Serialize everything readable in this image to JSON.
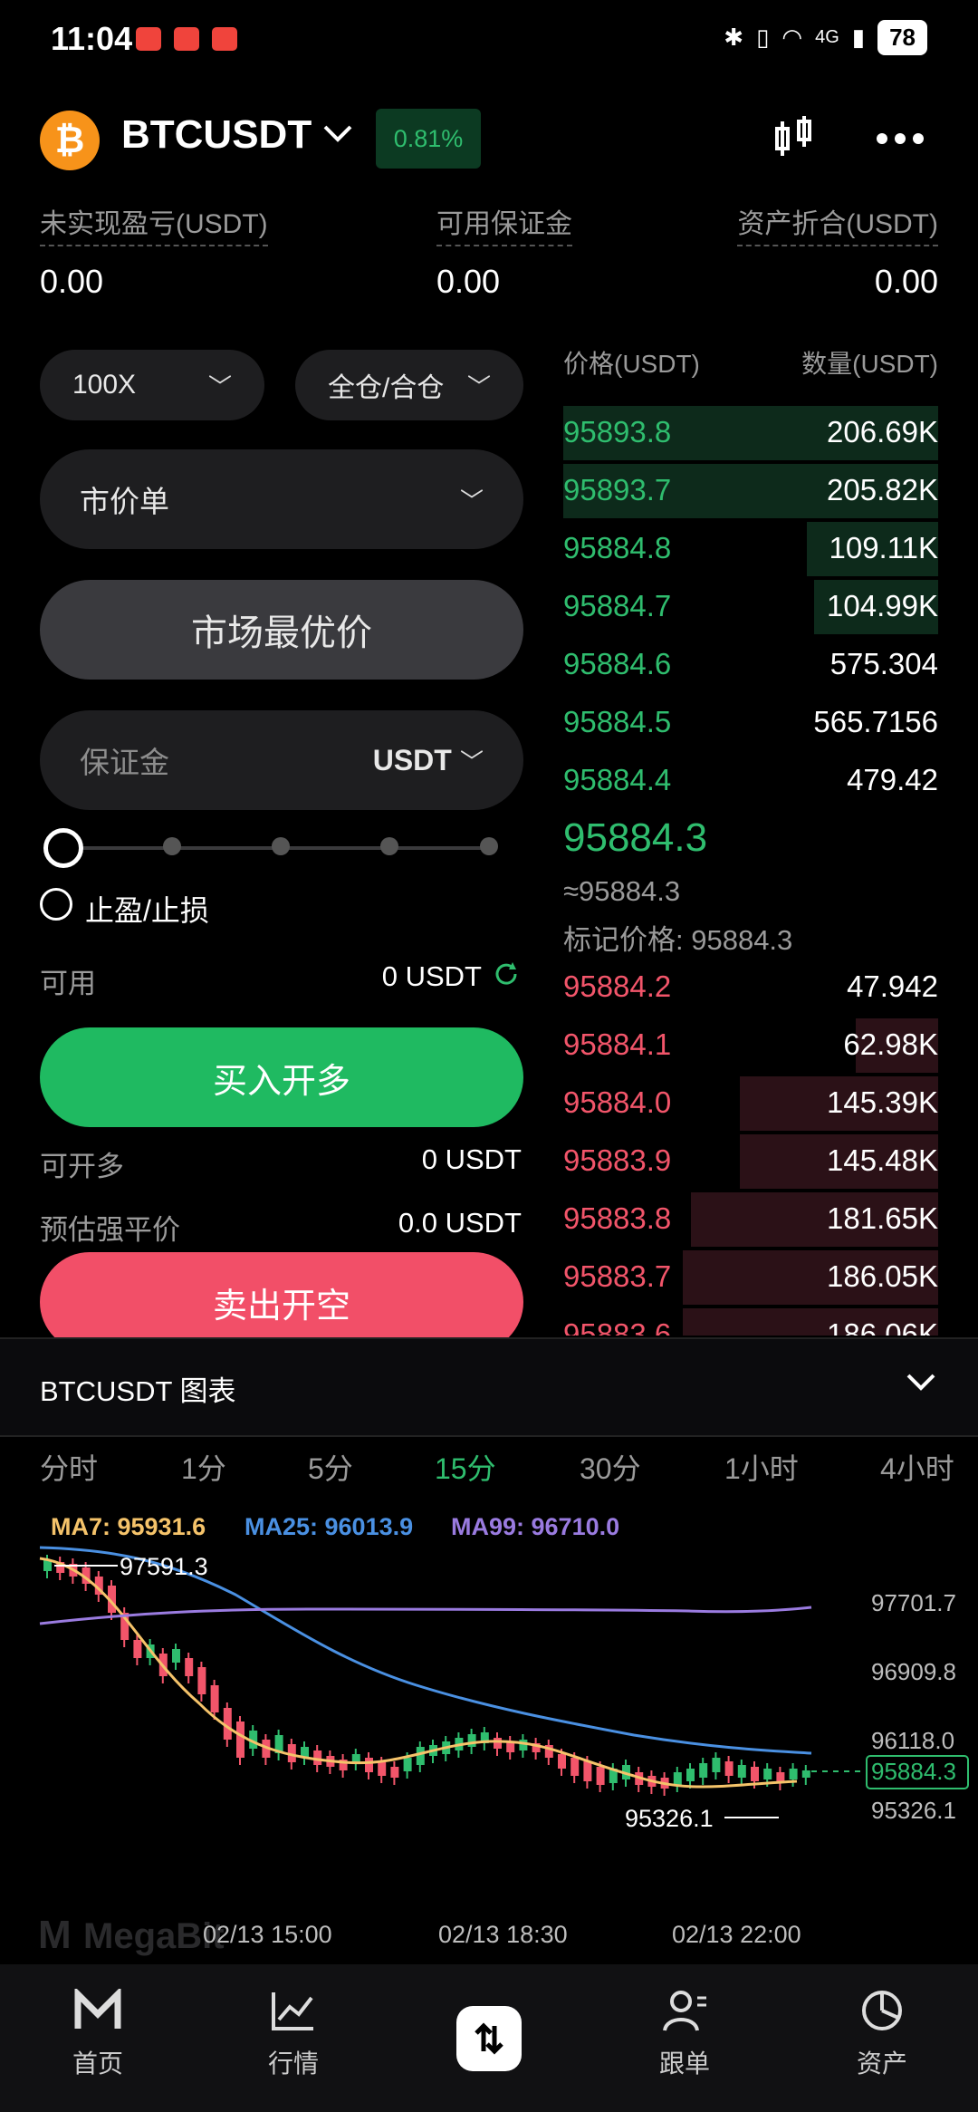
{
  "status_bar": {
    "time": "11:04",
    "battery": "78",
    "network": "4G"
  },
  "header": {
    "coin_symbol": "₿",
    "pair": "BTCUSDT",
    "change": "0.81%"
  },
  "balances": [
    {
      "label": "未实现盈亏(USDT)",
      "value": "0.00"
    },
    {
      "label": "可用保证金",
      "value": "0.00"
    },
    {
      "label": "资产折合(USDT)",
      "value": "0.00"
    }
  ],
  "order_form": {
    "leverage": "100X",
    "margin_mode": "全仓/合仓",
    "order_type": "市价单",
    "price_mode": "市场最优价",
    "margin_placeholder": "保证金",
    "margin_unit": "USDT",
    "tpsl_label": "止盈/止损",
    "available_label": "可用",
    "available_value": "0 USDT",
    "buy_label": "买入开多",
    "max_long_label": "可开多",
    "max_long_value": "0 USDT",
    "liq_label": "预估强平价",
    "liq_value": "0.0 USDT",
    "sell_label": "卖出开空"
  },
  "order_book": {
    "price_header": "价格(USDT)",
    "qty_header": "数量(USDT)",
    "asks": [
      {
        "price": "95893.8",
        "qty": "206.69K",
        "depth": 1.0
      },
      {
        "price": "95893.7",
        "qty": "205.82K",
        "depth": 1.0
      },
      {
        "price": "95884.8",
        "qty": "109.11K",
        "depth": 0.35
      },
      {
        "price": "95884.7",
        "qty": "104.99K",
        "depth": 0.33
      },
      {
        "price": "95884.6",
        "qty": "575.304",
        "depth": 0
      },
      {
        "price": "95884.5",
        "qty": "565.7156",
        "depth": 0
      },
      {
        "price": "95884.4",
        "qty": "479.42",
        "depth": 0
      }
    ],
    "last_price": "95884.3",
    "approx_price": "≈95884.3",
    "mark_price": "标记价格: 95884.3",
    "bids": [
      {
        "price": "95884.2",
        "qty": "47.942",
        "depth": 0
      },
      {
        "price": "95884.1",
        "qty": "62.98K",
        "depth": 0.22
      },
      {
        "price": "95884.0",
        "qty": "145.39K",
        "depth": 0.53
      },
      {
        "price": "95883.9",
        "qty": "145.48K",
        "depth": 0.53
      },
      {
        "price": "95883.8",
        "qty": "181.65K",
        "depth": 0.66
      },
      {
        "price": "95883.7",
        "qty": "186.05K",
        "depth": 0.68
      },
      {
        "price": "95883.6",
        "qty": "186.06K",
        "depth": 0.68
      }
    ]
  },
  "chart": {
    "title": "BTCUSDT  图表",
    "timeframes": [
      "分时",
      "1分",
      "5分",
      "15分",
      "30分",
      "1小时",
      "4小时"
    ],
    "active_timeframe": "15分",
    "ma7": "MA7: 95931.6",
    "ma25": "MA25: 96013.9",
    "ma99": "MA99: 96710.0",
    "colors": {
      "ma7": "#f5c36a",
      "ma25": "#4a90e2",
      "ma99": "#9a7be0",
      "up": "#2fbd6e",
      "down": "#f2556a"
    },
    "y_ticks": [
      "97701.7",
      "96909.8",
      "96118.0",
      "95326.1"
    ],
    "x_ticks": [
      "02/13 15:00",
      "02/13 18:30",
      "02/13 22:00"
    ],
    "high_label": "97591.3",
    "low_label": "95326.1",
    "current_price": "95884.3",
    "watermark": "MegaBit"
  },
  "nav": [
    {
      "label": "首页",
      "icon": "home-icon"
    },
    {
      "label": "行情",
      "icon": "market-icon"
    },
    {
      "label": "",
      "icon": "trade-icon"
    },
    {
      "label": "跟单",
      "icon": "copy-trade-icon"
    },
    {
      "label": "资产",
      "icon": "assets-icon"
    }
  ]
}
